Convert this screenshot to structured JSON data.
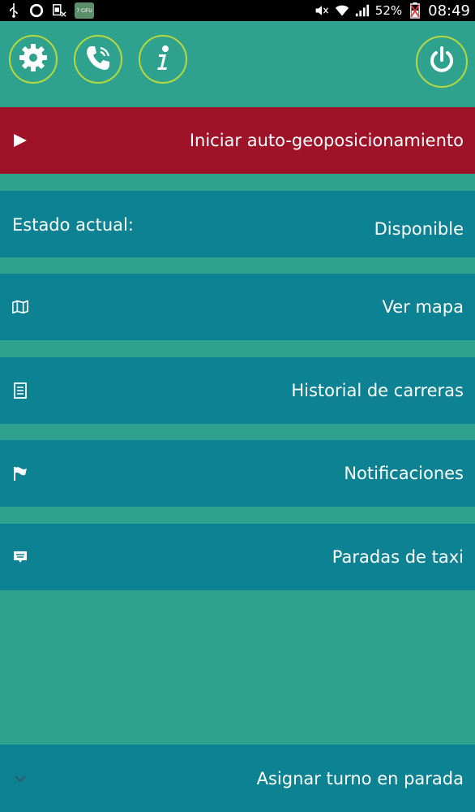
{
  "statusbar": {
    "battery_percent": "52%",
    "time": "08:49",
    "notif_badge": "7 CIFU"
  },
  "toolbar": {
    "icons": [
      "gear-icon",
      "phone-icon",
      "info-icon",
      "power-icon"
    ],
    "accent_color": "#b7d83d"
  },
  "geo": {
    "label": "Iniciar auto-geoposicionamiento",
    "color": "#9f1329"
  },
  "estado": {
    "label": "Estado actual:",
    "value": "Disponible"
  },
  "menu": {
    "ver_mapa": "Ver mapa",
    "historial": "Historial de carreras",
    "notificaciones": "Notificaciones",
    "paradas": "Paradas de taxi",
    "asignar": "Asignar turno en parada"
  },
  "colors": {
    "background": "#2fa28f",
    "row": "#0c8293"
  }
}
